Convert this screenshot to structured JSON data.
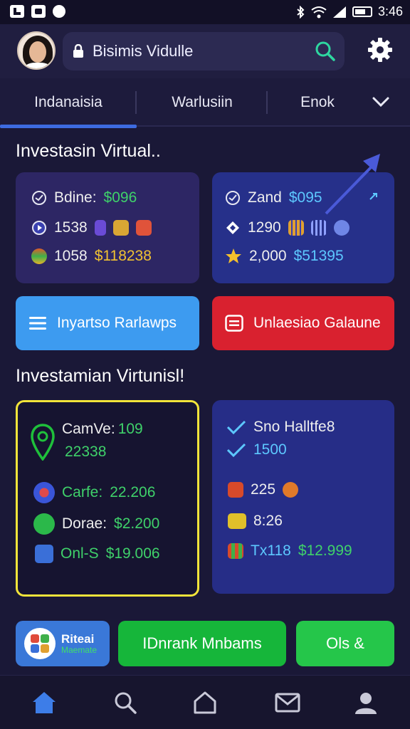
{
  "status_bar": {
    "time": "3:46"
  },
  "header": {
    "search_text": "Bisimis Vidulle"
  },
  "tabs": [
    {
      "label": "Indanaisia"
    },
    {
      "label": "Warlusiin"
    },
    {
      "label": "Enok"
    }
  ],
  "section1": {
    "title": "Investasin Virtual..",
    "card_left": {
      "rows": [
        {
          "label": "Bdine:",
          "value": "$096"
        },
        {
          "label": "1538",
          "value": ""
        },
        {
          "label": "1058",
          "value": "$118238"
        }
      ]
    },
    "card_right": {
      "rows": [
        {
          "label": "Zand",
          "value": "$095"
        },
        {
          "label": "1290",
          "value": ""
        },
        {
          "label": "2,000",
          "value": "$51395"
        }
      ]
    }
  },
  "buttons": {
    "left_label": "Inyartso Rarlawps",
    "right_label": "Unlaesiao Galaune"
  },
  "section2": {
    "title": "Investamian Virtunisl!",
    "card_left": {
      "head_label": "CamVe:",
      "head_value": "109",
      "head_sub": "22338",
      "rows": [
        {
          "label": "Carfe:",
          "value": "22.206"
        },
        {
          "label": "Dorae:",
          "value": "$2.200"
        },
        {
          "label": "Onl-S",
          "value": "$19.006"
        }
      ]
    },
    "card_right": {
      "rows": [
        {
          "label": "Sno Halltfe8"
        },
        {
          "label": "1500"
        },
        {
          "label": "225"
        },
        {
          "label": "8:26"
        },
        {
          "label": "Tx118",
          "value": "$12.999"
        }
      ]
    }
  },
  "bottom_actions": {
    "app_label_top": "Riteai",
    "app_label_bottom": "Maemate",
    "primary_label": "IDnrank Mnbams",
    "secondary_label": "Ols &"
  },
  "colors": {
    "accent_blue": "#3d9bf0",
    "accent_red": "#d9212f",
    "accent_green": "#1fc03b",
    "highlight_yellow": "#f2e43a",
    "card_purple": "#2b2566",
    "card_blue": "#262d87",
    "value_green": "#3fd16a",
    "value_cyan": "#5dc8ff"
  }
}
